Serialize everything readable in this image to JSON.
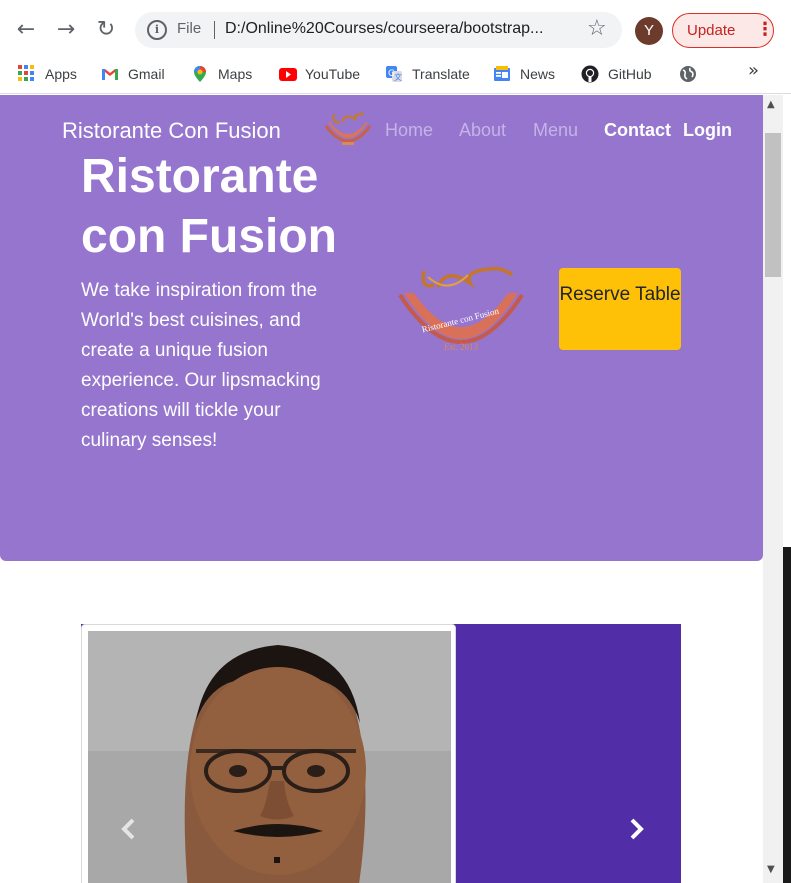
{
  "browser": {
    "url_scheme": "File",
    "url": "D:/Online%20Courses/courseera/bootstrap...",
    "profile_initial": "Y",
    "update_label": "Update"
  },
  "bookmarks": [
    {
      "label": "Apps",
      "icon": "apps-grid-icon"
    },
    {
      "label": "Gmail",
      "icon": "gmail-icon"
    },
    {
      "label": "Maps",
      "icon": "maps-pin-icon"
    },
    {
      "label": "YouTube",
      "icon": "youtube-icon"
    },
    {
      "label": "Translate",
      "icon": "translate-icon"
    },
    {
      "label": "News",
      "icon": "news-icon"
    },
    {
      "label": "GitHub",
      "icon": "github-icon"
    },
    {
      "label": "",
      "icon": "globe-icon"
    }
  ],
  "navbar": {
    "brand": "Ristorante Con Fusion",
    "links": [
      "Home",
      "About",
      "Menu",
      "Contact",
      "Login"
    ]
  },
  "hero": {
    "title": "Ristorante con Fusion",
    "text": "We take inspiration from the World's best cuisines, and create a unique fusion experience. Our lipsmacking creations will tickle your culinary senses!",
    "logo_text": "Ristorante con Fusion",
    "logo_year": "Est. 2013",
    "reserve_label": "Reserve Table"
  },
  "colors": {
    "jumbotron": "#9575cd",
    "carousel": "#512da8",
    "reserve_button": "#ffc107"
  }
}
